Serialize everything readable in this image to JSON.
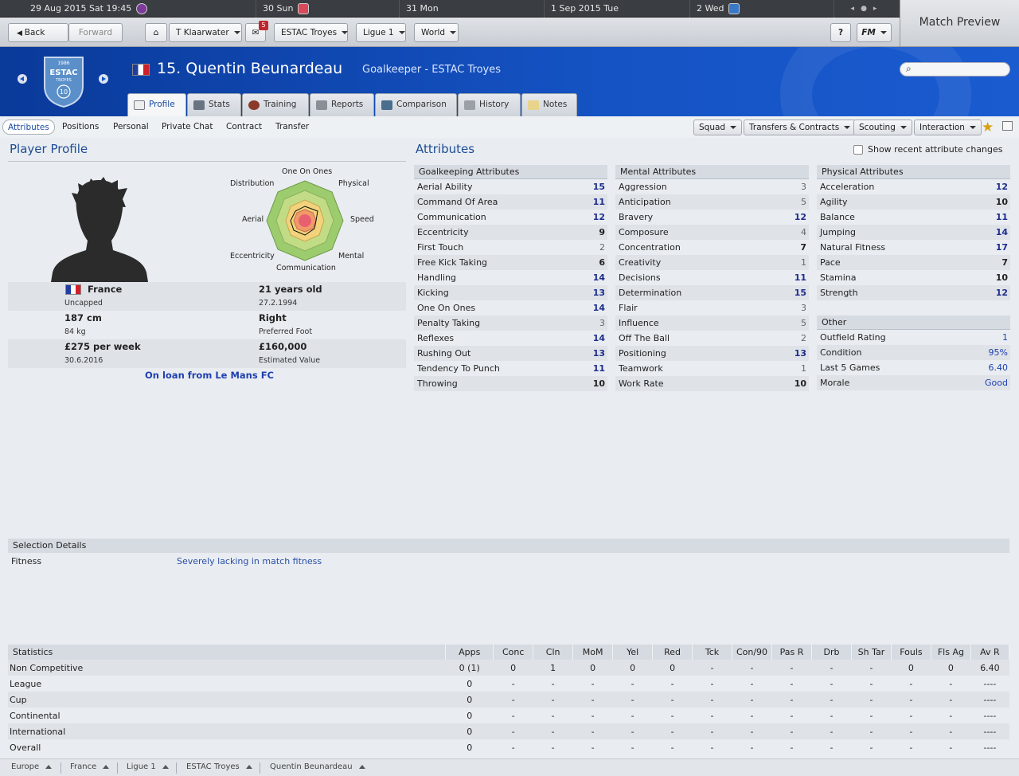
{
  "calendar": [
    {
      "label": "29 Aug 2015 Sat 19:45"
    },
    {
      "label": "30 Sun"
    },
    {
      "label": "31 Mon"
    },
    {
      "label": "1 Sep 2015 Tue"
    },
    {
      "label": "2 Wed"
    }
  ],
  "toolbar": {
    "back": "Back",
    "forward": "Forward",
    "manager": "T Klaarwater",
    "inbox_count": "5",
    "club": "ESTAC Troyes",
    "league": "Ligue 1",
    "world": "World",
    "help": "?",
    "fm": "FM",
    "match_preview": "Match Preview"
  },
  "header": {
    "name": "15. Quentin Beunardeau",
    "position": "Goalkeeper - ESTAC Troyes",
    "crest": {
      "year": "1986",
      "name": "ESTAC",
      "sub": "TROYES",
      "number": "10"
    }
  },
  "tabs": [
    "Profile",
    "Stats",
    "Training",
    "Reports",
    "Comparison",
    "History",
    "Notes"
  ],
  "subnav": [
    "Attributes",
    "Positions",
    "Personal",
    "Private Chat",
    "Contract",
    "Transfer"
  ],
  "actions": [
    "Squad",
    "Transfers & Contracts",
    "Scouting",
    "Interaction"
  ],
  "profile": {
    "title": "Player Profile",
    "radar_labels": [
      "One On Ones",
      "Physical",
      "Speed",
      "Mental",
      "Communication",
      "Eccentricity",
      "Aerial",
      "Distribution"
    ],
    "nation": "France",
    "caps": "Uncapped",
    "age": "21 years old",
    "dob": "27.2.1994",
    "height": "187 cm",
    "weight": "84 kg",
    "foot": "Right",
    "foot_label": "Preferred Foot",
    "wage": "£275 per week",
    "contract_end": "30.6.2016",
    "value": "£160,000",
    "value_label": "Estimated Value",
    "loan": "On loan from Le Mans FC"
  },
  "attributes": {
    "title": "Attributes",
    "show_changes": "Show recent attribute changes",
    "goalkeeping": {
      "title": "Goalkeeping Attributes",
      "items": [
        {
          "name": "Aerial Ability",
          "value": "15"
        },
        {
          "name": "Command Of Area",
          "value": "11"
        },
        {
          "name": "Communication",
          "value": "12"
        },
        {
          "name": "Eccentricity",
          "value": "9"
        },
        {
          "name": "First Touch",
          "value": "2"
        },
        {
          "name": "Free Kick Taking",
          "value": "6"
        },
        {
          "name": "Handling",
          "value": "14"
        },
        {
          "name": "Kicking",
          "value": "13"
        },
        {
          "name": "One On Ones",
          "value": "14"
        },
        {
          "name": "Penalty Taking",
          "value": "3"
        },
        {
          "name": "Reflexes",
          "value": "14"
        },
        {
          "name": "Rushing Out",
          "value": "13"
        },
        {
          "name": "Tendency To Punch",
          "value": "11"
        },
        {
          "name": "Throwing",
          "value": "10"
        }
      ]
    },
    "mental": {
      "title": "Mental Attributes",
      "items": [
        {
          "name": "Aggression",
          "value": "3"
        },
        {
          "name": "Anticipation",
          "value": "5"
        },
        {
          "name": "Bravery",
          "value": "12"
        },
        {
          "name": "Composure",
          "value": "4"
        },
        {
          "name": "Concentration",
          "value": "7"
        },
        {
          "name": "Creativity",
          "value": "1"
        },
        {
          "name": "Decisions",
          "value": "11"
        },
        {
          "name": "Determination",
          "value": "15"
        },
        {
          "name": "Flair",
          "value": "3"
        },
        {
          "name": "Influence",
          "value": "5"
        },
        {
          "name": "Off The Ball",
          "value": "2"
        },
        {
          "name": "Positioning",
          "value": "13"
        },
        {
          "name": "Teamwork",
          "value": "1"
        },
        {
          "name": "Work Rate",
          "value": "10"
        }
      ]
    },
    "physical": {
      "title": "Physical Attributes",
      "items": [
        {
          "name": "Acceleration",
          "value": "12"
        },
        {
          "name": "Agility",
          "value": "10"
        },
        {
          "name": "Balance",
          "value": "11"
        },
        {
          "name": "Jumping",
          "value": "14"
        },
        {
          "name": "Natural Fitness",
          "value": "17"
        },
        {
          "name": "Pace",
          "value": "7"
        },
        {
          "name": "Stamina",
          "value": "10"
        },
        {
          "name": "Strength",
          "value": "12"
        }
      ]
    },
    "other": {
      "title": "Other",
      "items": [
        {
          "name": "Outfield Rating",
          "value": "1"
        },
        {
          "name": "Condition",
          "value": "95%"
        },
        {
          "name": "Last 5 Games",
          "value": "6.40"
        },
        {
          "name": "Morale",
          "value": "Good"
        }
      ]
    }
  },
  "selection": {
    "title": "Selection Details",
    "label": "Fitness",
    "value": "Severely lacking in match fitness"
  },
  "statistics": {
    "columns": [
      "Statistics",
      "Apps",
      "Conc",
      "Cln",
      "MoM",
      "Yel",
      "Red",
      "Tck",
      "Con/90",
      "Pas R",
      "Drb",
      "Sh Tar",
      "Fouls",
      "Fls Ag",
      "Av R"
    ],
    "rows": [
      [
        "Non Competitive",
        "0 (1)",
        "0",
        "1",
        "0",
        "0",
        "0",
        "-",
        "-",
        "-",
        "-",
        "-",
        "0",
        "0",
        "6.40"
      ],
      [
        "League",
        "0",
        "-",
        "-",
        "-",
        "-",
        "-",
        "-",
        "-",
        "-",
        "-",
        "-",
        "-",
        "-",
        "----"
      ],
      [
        "Cup",
        "0",
        "-",
        "-",
        "-",
        "-",
        "-",
        "-",
        "-",
        "-",
        "-",
        "-",
        "-",
        "-",
        "----"
      ],
      [
        "Continental",
        "0",
        "-",
        "-",
        "-",
        "-",
        "-",
        "-",
        "-",
        "-",
        "-",
        "-",
        "-",
        "-",
        "----"
      ],
      [
        "International",
        "0",
        "-",
        "-",
        "-",
        "-",
        "-",
        "-",
        "-",
        "-",
        "-",
        "-",
        "-",
        "-",
        "----"
      ],
      [
        "Overall",
        "0",
        "-",
        "-",
        "-",
        "-",
        "-",
        "-",
        "-",
        "-",
        "-",
        "-",
        "-",
        "-",
        "----"
      ]
    ]
  },
  "breadcrumbs": [
    "Europe",
    "France",
    "Ligue 1",
    "ESTAC Troyes",
    "Quentin Beunardeau"
  ],
  "colors": {
    "accent": "#1553c4",
    "header_text": "#1d4c95",
    "high_value": "#1e2d8c"
  }
}
